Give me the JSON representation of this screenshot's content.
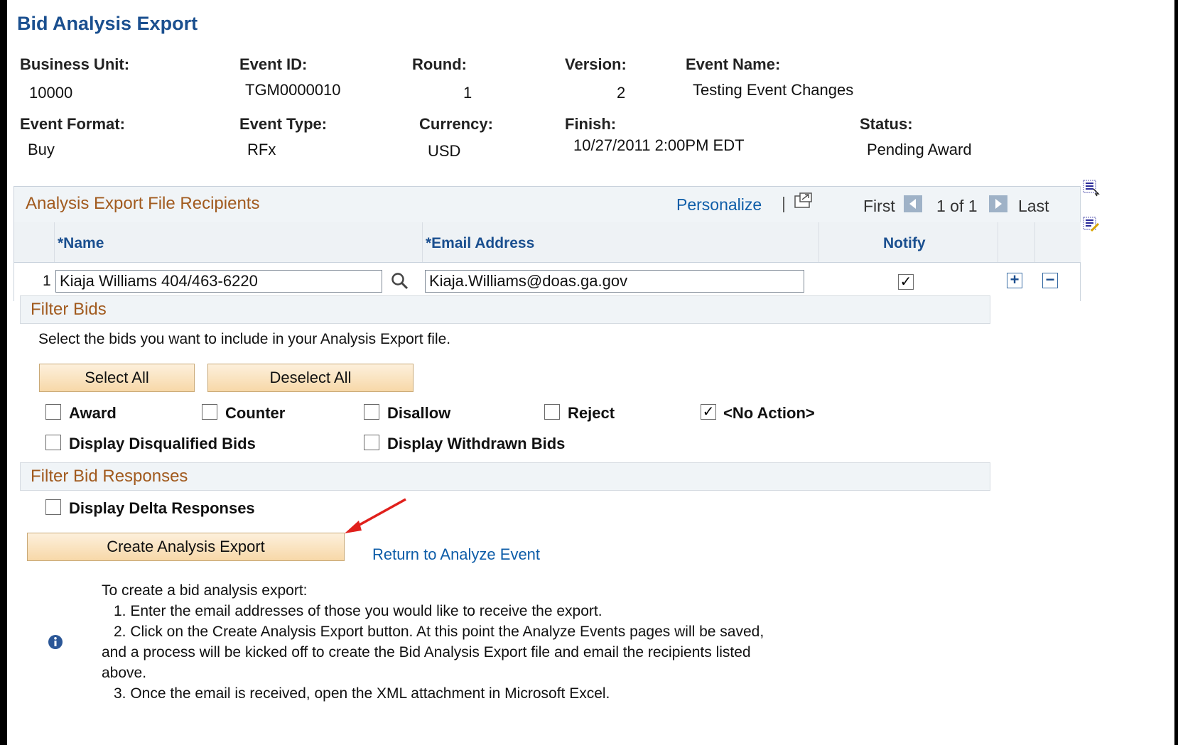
{
  "page": {
    "title": "Bid Analysis Export"
  },
  "header": {
    "business_unit": {
      "label": "Business Unit:",
      "value": "10000"
    },
    "event_id": {
      "label": "Event ID:",
      "value": "TGM0000010"
    },
    "round": {
      "label": "Round:",
      "value": "1"
    },
    "version": {
      "label": "Version:",
      "value": "2"
    },
    "event_name": {
      "label": "Event Name:",
      "value": "Testing Event Changes"
    },
    "event_format": {
      "label": "Event Format:",
      "value": "Buy"
    },
    "event_type": {
      "label": "Event Type:",
      "value": "RFx"
    },
    "currency": {
      "label": "Currency:",
      "value": "USD"
    },
    "finish": {
      "label": "Finish:",
      "value": "10/27/2011 2:00PM EDT"
    },
    "status": {
      "label": "Status:",
      "value": "Pending Award"
    }
  },
  "grid": {
    "title": "Analysis Export File Recipients",
    "personalize": "Personalize",
    "separator": "|",
    "first": "First",
    "page_info": "1 of 1",
    "last": "Last",
    "columns": {
      "name": "*Name",
      "email": "*Email Address",
      "notify": "Notify"
    },
    "rows": [
      {
        "num": "1",
        "name": "Kiaja Williams 404/463-6220",
        "email": "Kiaja.Williams@doas.ga.gov",
        "notify": true
      }
    ]
  },
  "filter_bids": {
    "title": "Filter Bids",
    "instructions": "Select the bids you want to include in your Analysis Export file.",
    "select_all": "Select All",
    "deselect_all": "Deselect All",
    "options": {
      "award": {
        "label": "Award",
        "checked": false
      },
      "counter": {
        "label": "Counter",
        "checked": false
      },
      "disallow": {
        "label": "Disallow",
        "checked": false
      },
      "reject": {
        "label": "Reject",
        "checked": false
      },
      "no_action": {
        "label": "<No Action>",
        "checked": true
      },
      "disqualified": {
        "label": "Display Disqualified Bids",
        "checked": false
      },
      "withdrawn": {
        "label": "Display Withdrawn Bids",
        "checked": false
      }
    }
  },
  "filter_responses": {
    "title": "Filter Bid Responses",
    "delta": {
      "label": "Display Delta Responses",
      "checked": false
    }
  },
  "actions": {
    "create_export": "Create Analysis Export",
    "return_link": "Return to Analyze Event"
  },
  "help": {
    "intro": "To create a bid analysis export:",
    "step1": "1. Enter the email addresses of those you would like to receive the export.",
    "step2a": "2. Click on the Create Analysis Export button. At this point the Analyze Events pages will be saved,",
    "step2b": "and a process will be kicked off to create the Bid Analysis Export file and email the recipients listed",
    "step2c": "above.",
    "step3": "3. Once the email is received, open the XML attachment in Microsoft Excel."
  },
  "colors": {
    "title": "#1a4f8f",
    "section": "#a15a1e",
    "link": "#0e5da8",
    "annotation_arrow": "#e0201c"
  }
}
